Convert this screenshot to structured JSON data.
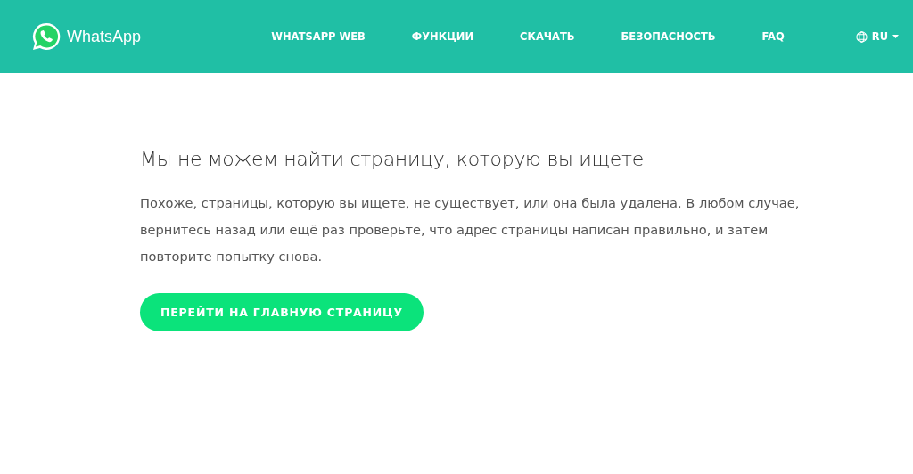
{
  "header": {
    "brand": "WhatsApp",
    "nav": [
      {
        "label": "WHATSAPP WEB"
      },
      {
        "label": "ФУНКЦИИ"
      },
      {
        "label": "СКАЧАТЬ"
      },
      {
        "label": "БЕЗОПАСНОСТЬ"
      },
      {
        "label": "FAQ"
      }
    ],
    "language": "RU"
  },
  "content": {
    "title": "Мы не можем найти страницу, которую вы ищете",
    "message": "Похоже, страницы, которую вы ищете, не существует, или она была удалена. В любом случае, вернитесь назад или ещё раз проверьте, что адрес страницы написан правильно, и затем повторите попытку снова.",
    "button": "ПЕРЕЙТИ НА ГЛАВНУЮ СТРАНИЦУ"
  }
}
